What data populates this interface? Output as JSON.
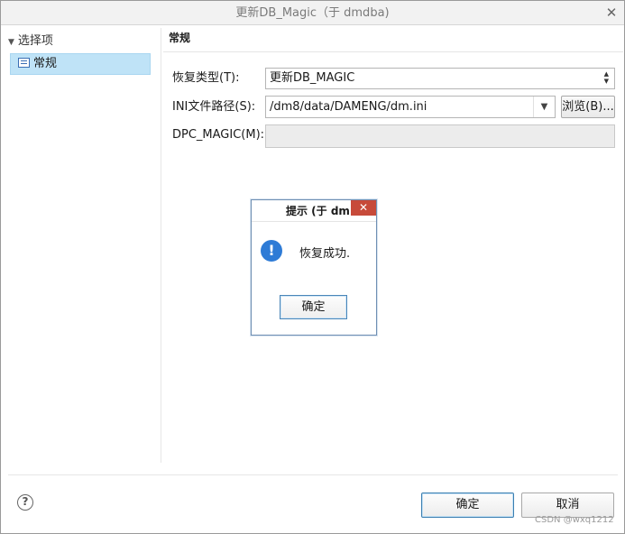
{
  "window": {
    "title": "更新DB_Magic（于 dmdba)",
    "close_glyph": "✕"
  },
  "sidebar": {
    "root_label": "选择项",
    "items": [
      {
        "label": "常规",
        "selected": true
      }
    ]
  },
  "section": {
    "title": "常规"
  },
  "form": {
    "restore_type_label": "恢复类型(T):",
    "restore_type_value": "更新DB_MAGIC",
    "ini_path_label": "INI文件路径(S):",
    "ini_path_value": "/dm8/data/DAMENG/dm.ini",
    "browse_label": "浏览(B)...",
    "dpc_magic_label": "DPC_MAGIC(M):",
    "dpc_magic_value": ""
  },
  "footer": {
    "help_glyph": "?",
    "ok_label": "确定",
    "cancel_label": "取消",
    "watermark": "CSDN @wxq1212"
  },
  "modal": {
    "title": "提示    (于 dm",
    "close_glyph": "✕",
    "icon_glyph": "!",
    "message": "恢复成功.",
    "ok_label": "确定"
  },
  "colors": {
    "selection": "#bfe3f7",
    "info_icon": "#2e7bd6",
    "close_button": "#c74a3a"
  }
}
